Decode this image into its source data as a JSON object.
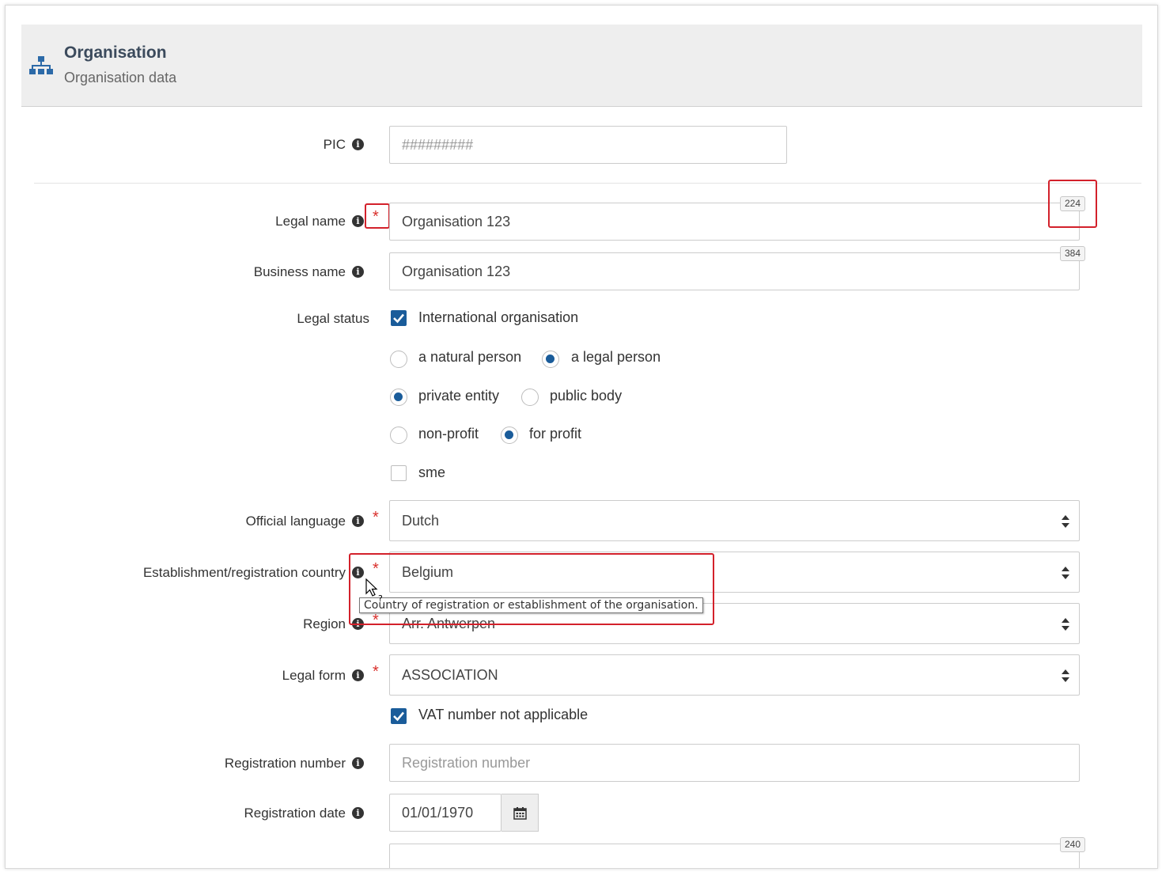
{
  "header": {
    "title": "Organisation",
    "subtitle": "Organisation data",
    "icon": "sitemap-icon"
  },
  "fields": {
    "pic": {
      "label": "PIC",
      "placeholder": "#########"
    },
    "legal_name": {
      "label": "Legal name",
      "value": "Organisation 123",
      "counter": "224",
      "required": "*"
    },
    "business_name": {
      "label": "Business name",
      "value": "Organisation 123",
      "counter": "384"
    },
    "legal_status": {
      "label": "Legal status",
      "international": {
        "label": "International organisation",
        "checked": true
      },
      "natural_person": {
        "label": "a natural person",
        "checked": false
      },
      "legal_person": {
        "label": "a legal person",
        "checked": true
      },
      "private_entity": {
        "label": "private entity",
        "checked": true
      },
      "public_body": {
        "label": "public body",
        "checked": false
      },
      "non_profit": {
        "label": "non-profit",
        "checked": false
      },
      "for_profit": {
        "label": "for profit",
        "checked": true
      },
      "sme": {
        "label": "sme",
        "checked": false
      }
    },
    "official_language": {
      "label": "Official language",
      "value": "Dutch",
      "required": "*"
    },
    "country": {
      "label": "Establishment/registration country",
      "value": "Belgium",
      "required": "*",
      "tooltip": "Country of registration or establishment of the organisation."
    },
    "region": {
      "label": "Region",
      "value": "Arr. Antwerpen",
      "required": "*"
    },
    "legal_form": {
      "label": "Legal form",
      "value": "ASSOCIATION",
      "required": "*"
    },
    "vat_not_applicable": {
      "label": "VAT number not applicable",
      "checked": true
    },
    "registration_number": {
      "label": "Registration number",
      "placeholder": "Registration number"
    },
    "registration_date": {
      "label": "Registration date",
      "value": "01/01/1970"
    },
    "next_field": {
      "counter": "240"
    }
  },
  "colors": {
    "accent": "#1a5c9a",
    "required": "#d9302c",
    "highlight": "#d3212b",
    "header_bg": "#eeeeee"
  }
}
